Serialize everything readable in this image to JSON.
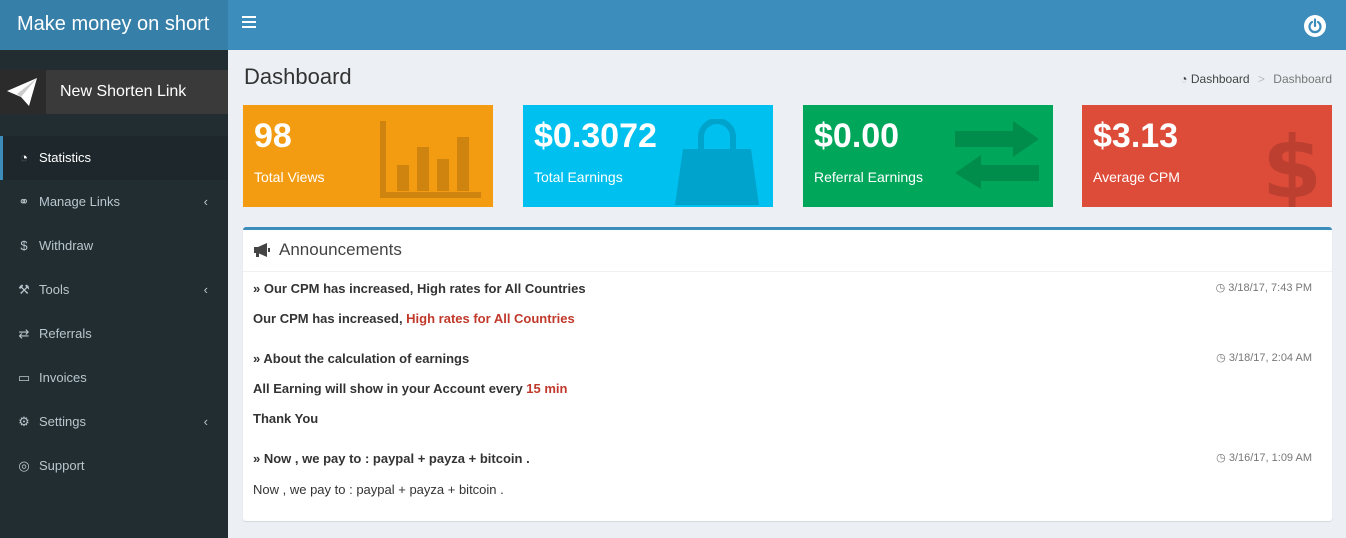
{
  "brand": "Make money on short",
  "sidebar": {
    "new_link": "New Shorten Link",
    "items": [
      {
        "label": "Statistics"
      },
      {
        "label": "Manage Links"
      },
      {
        "label": "Withdraw"
      },
      {
        "label": "Tools"
      },
      {
        "label": "Referrals"
      },
      {
        "label": "Invoices"
      },
      {
        "label": "Settings"
      },
      {
        "label": "Support"
      }
    ]
  },
  "page": {
    "title": "Dashboard",
    "breadcrumb": [
      "Dashboard",
      "Dashboard"
    ]
  },
  "stats": [
    {
      "value": "98",
      "label": "Total Views",
      "color": "#f39c12"
    },
    {
      "value": "$0.3072",
      "label": "Total Earnings",
      "color": "#00c0ef"
    },
    {
      "value": "$0.00",
      "label": "Referral Earnings",
      "color": "#00a65a"
    },
    {
      "value": "$3.13",
      "label": "Average CPM",
      "color": "#dd4b39"
    }
  ],
  "announcements": {
    "title": "Announcements",
    "items": [
      {
        "heading": "Our CPM has increased, High rates for All Countries",
        "time": "3/18/17, 7:43 PM",
        "body_prefix": "Our CPM has increased, ",
        "body_highlight": "High rates for All Countries"
      },
      {
        "heading": "About the calculation of earnings",
        "time": "3/18/17, 2:04 AM",
        "body_prefix": "All Earning will show in your Account every ",
        "body_highlight": "15 min",
        "body_extra": "Thank You"
      },
      {
        "heading": "Now , we pay to : paypal + payza + bitcoin .",
        "time": "3/16/17, 1:09 AM",
        "body": "Now , we pay to : paypal + payza + bitcoin ."
      }
    ]
  }
}
